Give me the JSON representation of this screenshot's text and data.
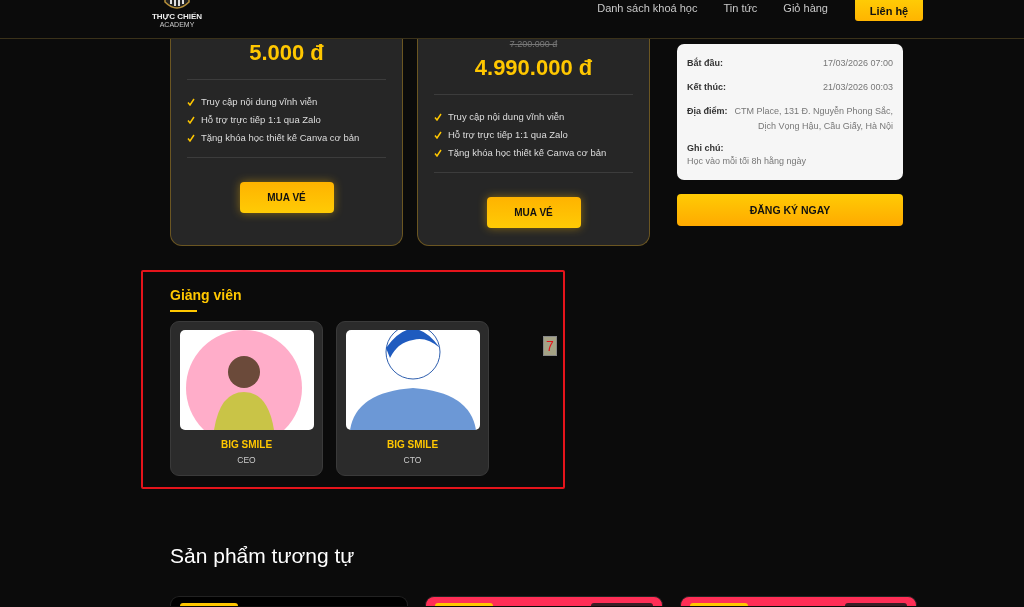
{
  "header": {
    "logo": {
      "title": "THỰC CHIẾN",
      "subtitle": "ACADEMY"
    },
    "nav": [
      {
        "label": "Danh sách khoá học",
        "kind": "link"
      },
      {
        "label": "Tin tức",
        "kind": "link"
      },
      {
        "label": "Giỏ hàng",
        "kind": "link"
      },
      {
        "label": "Liên hệ",
        "kind": "button"
      }
    ]
  },
  "tickets": [
    {
      "price": "5.000 đ",
      "features": [
        "Truy cập nội dung vĩnh viễn",
        "Hỗ trợ trực tiếp 1:1 qua Zalo",
        "Tặng khóa học thiết kế Canva cơ bản"
      ],
      "button": "MUA VÉ"
    },
    {
      "old_price": "7.200.000 đ",
      "price": "4.990.000 đ",
      "features": [
        "Truy cập nội dung vĩnh viễn",
        "Hỗ trợ trực tiếp 1:1 qua Zalo",
        "Tặng khóa học thiết kế Canva cơ bản"
      ],
      "button": "MUA VÉ"
    }
  ],
  "event_info": {
    "rows": [
      {
        "label": "Bắt đầu:",
        "value": "17/03/2026 07:00",
        "kind": "inline"
      },
      {
        "label": "Kết thúc:",
        "value": "21/03/2026 00:03",
        "kind": "inline"
      },
      {
        "label": "Địa điểm:",
        "value": "CTM Place, 131 Đ. Nguyễn Phong Sắc, Dịch Vọng Hậu, Cầu Giấy, Hà Nội",
        "kind": "inline"
      },
      {
        "label": "Ghi chú:",
        "value": "Học vào mỗi tối 8h hằng ngày",
        "kind": "stacked"
      }
    ],
    "button": "ĐĂNG KÝ NGAY"
  },
  "instructors": {
    "title": "Giảng viên",
    "items": [
      {
        "name": "BIG SMILE",
        "role": "CEO",
        "kind": "pink"
      },
      {
        "name": "BIG SMILE",
        "role": "CTO",
        "kind": "blue"
      }
    ],
    "highlight": {
      "label": "7"
    }
  },
  "similar": {
    "title": "Sản phẩm tương tự",
    "cards": [
      {
        "kind": "dark"
      },
      {
        "kind": "pink"
      },
      {
        "kind": "pink"
      }
    ]
  }
}
